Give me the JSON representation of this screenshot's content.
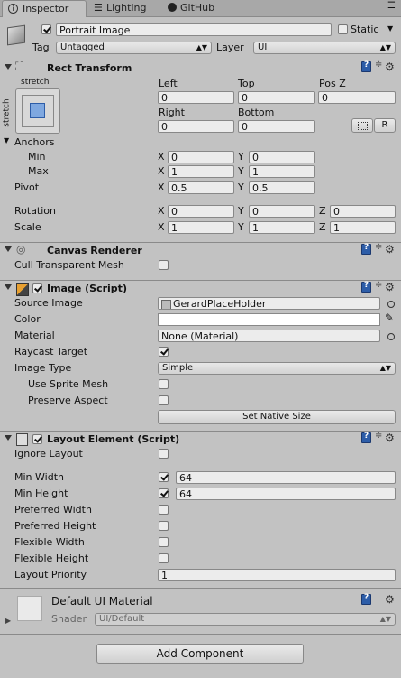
{
  "tabs": [
    {
      "label": "Inspector"
    },
    {
      "label": "Lighting"
    },
    {
      "label": "GitHub"
    }
  ],
  "object": {
    "name": "Portrait Image",
    "static_label": "Static",
    "tag_label": "Tag",
    "tag_value": "Untagged",
    "layer_label": "Layer",
    "layer_value": "UI"
  },
  "rect_transform": {
    "title": "Rect Transform",
    "anchor_preset_top": "stretch",
    "anchor_preset_side": "stretch",
    "left_label": "Left",
    "left_value": "0",
    "top_label": "Top",
    "top_value": "0",
    "posz_label": "Pos Z",
    "posz_value": "0",
    "right_label": "Right",
    "right_value": "0",
    "bottom_label": "Bottom",
    "bottom_value": "0",
    "r_button": "R",
    "anchors_label": "Anchors",
    "min_label": "Min",
    "min_x": "0",
    "min_y": "0",
    "max_label": "Max",
    "max_x": "1",
    "max_y": "1",
    "pivot_label": "Pivot",
    "pivot_x": "0.5",
    "pivot_y": "0.5",
    "rotation_label": "Rotation",
    "rot_x": "0",
    "rot_y": "0",
    "rot_z": "0",
    "scale_label": "Scale",
    "scale_x": "1",
    "scale_y": "1",
    "scale_z": "1",
    "x": "X",
    "y": "Y",
    "z": "Z"
  },
  "canvas_renderer": {
    "title": "Canvas Renderer",
    "cull_label": "Cull Transparent Mesh",
    "cull_checked": false
  },
  "image": {
    "title": "Image (Script)",
    "source_label": "Source Image",
    "source_value": "GerardPlaceHolder",
    "color_label": "Color",
    "color_value": "#ffffff",
    "material_label": "Material",
    "material_value": "None (Material)",
    "raycast_label": "Raycast Target",
    "raycast_checked": true,
    "type_label": "Image Type",
    "type_value": "Simple",
    "sprite_mesh_label": "Use Sprite Mesh",
    "preserve_label": "Preserve Aspect",
    "set_native_button": "Set Native Size"
  },
  "layout_element": {
    "title": "Layout Element (Script)",
    "ignore_label": "Ignore Layout",
    "min_width_label": "Min Width",
    "min_width_value": "64",
    "min_height_label": "Min Height",
    "min_height_value": "64",
    "pref_width_label": "Preferred Width",
    "pref_height_label": "Preferred Height",
    "flex_width_label": "Flexible Width",
    "flex_height_label": "Flexible Height",
    "priority_label": "Layout Priority",
    "priority_value": "1"
  },
  "material": {
    "name": "Default UI Material",
    "shader_label": "Shader",
    "shader_value": "UI/Default"
  },
  "add_component_button": "Add Component"
}
